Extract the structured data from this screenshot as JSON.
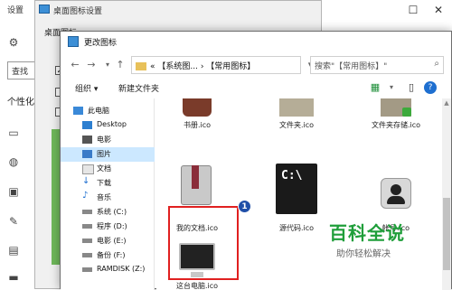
{
  "settings": {
    "title": "设置",
    "search_placeholder": "查找",
    "section_label": "个性化"
  },
  "desktop_icon_dialog": {
    "title": "桌面图标设置",
    "tab_label": "桌面图标"
  },
  "change_icon_dialog": {
    "title": "更改图标",
    "address": {
      "chevron": "«",
      "path": "【系统图... › 【常用图标】"
    },
    "search_placeholder": "搜索\"【常用图标】\"",
    "toolbar": {
      "organize": "组织 ▾",
      "new_folder": "新建文件夹"
    },
    "nav_items": [
      {
        "label": "此电脑",
        "icon": "computer-icon"
      },
      {
        "label": "Desktop",
        "icon": "desktop-folder-icon"
      },
      {
        "label": "电影",
        "icon": "video-folder-icon"
      },
      {
        "label": "图片",
        "icon": "pictures-folder-icon",
        "selected": true
      },
      {
        "label": "文档",
        "icon": "documents-folder-icon"
      },
      {
        "label": "下载",
        "icon": "download-icon"
      },
      {
        "label": "音乐",
        "icon": "music-icon"
      },
      {
        "label": "系统 (C:)",
        "icon": "drive-icon"
      },
      {
        "label": "程序 (D:)",
        "icon": "drive-icon"
      },
      {
        "label": "电影 (E:)",
        "icon": "drive-icon"
      },
      {
        "label": "备份 (F:)",
        "icon": "drive-icon"
      },
      {
        "label": "RAMDISK (Z:)",
        "icon": "drive-icon"
      }
    ],
    "files": [
      {
        "label": "书册.ico",
        "icon": "book-icon"
      },
      {
        "label": "文件夹.ico",
        "icon": "folder-icon"
      },
      {
        "label": "文件夹存储.ico",
        "icon": "folder-storage-icon"
      },
      {
        "label": "我的文档.ico",
        "icon": "my-documents-icon"
      },
      {
        "label": "源代码.ico",
        "icon": "source-code-icon"
      },
      {
        "label": "帐号.ico",
        "icon": "account-icon"
      },
      {
        "label": "这台电脑.ico",
        "icon": "this-pc-icon",
        "selected": true
      }
    ],
    "cmd_text": "C:\\"
  },
  "annotation": {
    "badge": "1"
  },
  "watermark": {
    "title": "百科全说",
    "subtitle": "助你轻松解决"
  },
  "colors": {
    "selection_red": "#e02020",
    "badge_blue": "#1f4fa8",
    "watermark_green": "#1f9e3a",
    "nav_selected": "#cce8ff"
  }
}
